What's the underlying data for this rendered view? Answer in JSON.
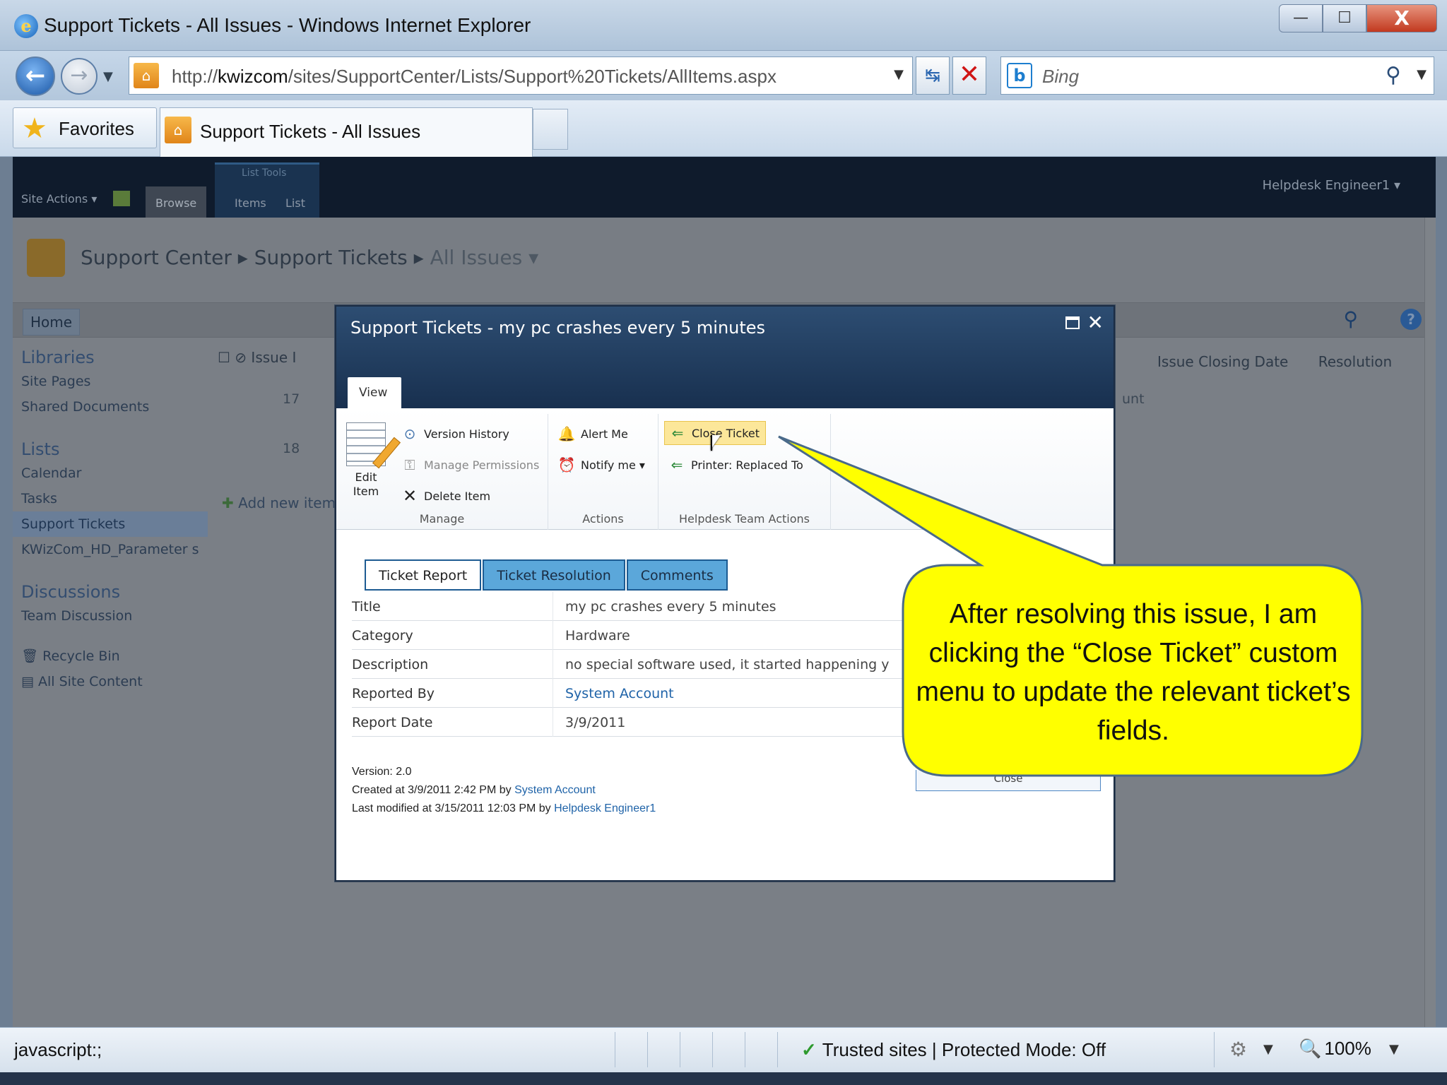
{
  "window": {
    "title": "Support Tickets - All Issues - Windows Internet Explorer",
    "minimize_glyph": "—",
    "maximize_glyph": "☐",
    "close_glyph": "X"
  },
  "address_bar": {
    "url_prefix": "http://",
    "url_host": "kwizcom",
    "url_path": "/sites/SupportCenter/Lists/Support%20Tickets/AllItems.aspx",
    "search_placeholder": "Bing"
  },
  "favorites_bar": {
    "favorites_label": "Favorites",
    "active_tab_label": "Support Tickets - All Issues"
  },
  "sharepoint": {
    "site_actions": "Site Actions ▾",
    "ribbon_tabs": [
      "Browse",
      "Items",
      "List"
    ],
    "list_tools_label": "List Tools",
    "user": "Helpdesk Engineer1 ▾",
    "breadcrumb": [
      "Support Center",
      "Support Tickets",
      "All Issues ▾"
    ],
    "home_tab": "Home",
    "quick_launch": {
      "libraries_heading": "Libraries",
      "libraries": [
        "Site Pages",
        "Shared Documents"
      ],
      "lists_heading": "Lists",
      "lists": [
        "Calendar",
        "Tasks",
        "Support Tickets",
        "KWizCom_HD_Parameter s"
      ],
      "discussions_heading": "Discussions",
      "discussions": [
        "Team Discussion"
      ],
      "recycle_bin": "Recycle Bin",
      "all_site_content": "All Site Content"
    },
    "list_columns_left": "Issue I",
    "list_columns_right": [
      "Issue Closing Date",
      "Resolution"
    ],
    "row_ids": [
      "17",
      "18"
    ],
    "partial_cell": "unt",
    "add_new_item": "Add new item"
  },
  "dialog": {
    "title": "Support Tickets - my pc crashes every 5 minutes",
    "view_tab": "View",
    "ribbon": {
      "edit_item": "Edit Item",
      "manage": {
        "label": "Manage",
        "version_history": "Version History",
        "manage_permissions": "Manage Permissions",
        "delete_item": "Delete Item"
      },
      "actions": {
        "label": "Actions",
        "alert_me": "Alert Me",
        "notify_me": "Notify me ▾"
      },
      "helpdesk": {
        "label": "Helpdesk Team Actions",
        "close_ticket": "Close Ticket",
        "printer_replaced": "Printer: Replaced To"
      }
    },
    "form_tabs": [
      "Ticket Report",
      "Ticket Resolution",
      "Comments"
    ],
    "fields": [
      {
        "label": "Title",
        "value": "my pc crashes every 5 minutes"
      },
      {
        "label": "Category",
        "value": "Hardware"
      },
      {
        "label": "Description",
        "value": "no special software used, it started happening y"
      },
      {
        "label": "Reported By",
        "value": "System Account"
      },
      {
        "label": "Report Date",
        "value": "3/9/2011"
      }
    ],
    "meta": {
      "version": "Version: 2.0",
      "created_prefix": "Created at 3/9/2011 2:42 PM by",
      "created_by": "System Account",
      "modified_prefix": "Last modified at 3/15/2011 12:03 PM by",
      "modified_by": "Helpdesk Engineer1"
    },
    "close_button_fragment": "Close"
  },
  "callout": {
    "text": "After resolving this issue, I am clicking the  “Close Ticket” custom menu to update the relevant ticket’s fields.",
    "fill": "#ffff00",
    "stroke": "#4a6a8a"
  },
  "status_bar": {
    "left_text": "javascript:;",
    "zone": "Trusted sites | Protected Mode: Off",
    "zoom": "100%"
  }
}
